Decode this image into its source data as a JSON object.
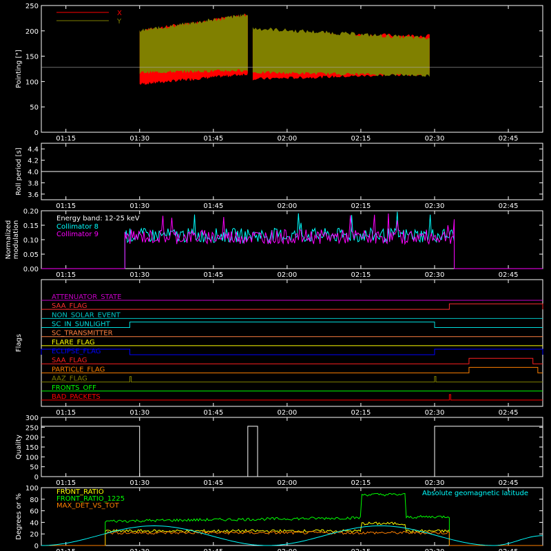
{
  "time_axis": {
    "start": "01:10",
    "end": "02:52",
    "tick_labels": [
      "01:15",
      "01:30",
      "01:45",
      "02:00",
      "02:15",
      "02:30",
      "02:45"
    ]
  },
  "chart_data": [
    {
      "id": "pointing",
      "type": "line",
      "ylabel": "Pointing [\"]",
      "ylim": [
        0,
        250
      ],
      "yticks": [
        0,
        50,
        100,
        150,
        200,
        250
      ],
      "reference_line": 128,
      "series": [
        {
          "name": "X",
          "color": "#ff0000",
          "bands": [
            {
              "t0": "01:30",
              "t1": "01:52",
              "low_start": 95,
              "low_end": 115,
              "high_start": 200,
              "high_end": 232
            },
            {
              "t0": "01:53",
              "t1": "02:29",
              "low_start": 105,
              "low_end": 115,
              "high_start": 195,
              "high_end": 190
            }
          ]
        },
        {
          "name": "Y",
          "color": "#808000",
          "bands": [
            {
              "t0": "01:30",
              "t1": "01:52",
              "low_start": 118,
              "low_end": 122,
              "high_start": 200,
              "high_end": 232
            },
            {
              "t0": "01:53",
              "t1": "02:29",
              "low_start": 118,
              "low_end": 112,
              "high_start": 205,
              "high_end": 185
            }
          ]
        }
      ]
    },
    {
      "id": "roll",
      "type": "line",
      "ylabel": "Roll period [s]",
      "ylim": [
        3.5,
        4.5
      ],
      "yticks": [
        3.6,
        3.8,
        4.0,
        4.2,
        4.4
      ],
      "series": [
        {
          "color": "#ffffff",
          "t": [
            "01:10",
            "02:52"
          ],
          "y": [
            4.0,
            4.0
          ]
        }
      ]
    },
    {
      "id": "modulation",
      "type": "line",
      "ylabel": "Normalized modulation",
      "ylim": [
        0,
        0.2
      ],
      "yticks": [
        0.0,
        0.05,
        0.1,
        0.15,
        0.2
      ],
      "annotation": "Energy band: 12-25 keV",
      "active_window": [
        "01:27",
        "02:34"
      ],
      "series": [
        {
          "name": "Collimator 8",
          "color": "#00ffff",
          "mean": 0.115
        },
        {
          "name": "Collimator 9",
          "color": "#ff00ff",
          "mean": 0.11
        }
      ]
    },
    {
      "id": "flags",
      "type": "line",
      "ylabel": "Flags",
      "flags": [
        {
          "name": "ATTENUATOR_STATE",
          "color": "#c800c8",
          "steps": []
        },
        {
          "name": "SAA_FLAG",
          "color": "#ff3030",
          "steps": [
            [
              "02:33",
              "02:52"
            ]
          ]
        },
        {
          "name": "NON_SOLAR_EVENT",
          "color": "#00c8c8",
          "steps": []
        },
        {
          "name": "SC_IN_SUNLIGHT",
          "color": "#00e0e0",
          "steps": [
            [
              "01:28",
              "02:30"
            ]
          ]
        },
        {
          "name": "SC_TRANSMITTER",
          "color": "#ff8040",
          "steps": []
        },
        {
          "name": "FLARE_FLAG",
          "color": "#ffff00",
          "steps": []
        },
        {
          "name": "ECLIPSE_FLAG",
          "color": "#0000ff",
          "steps": [
            [
              "01:10",
              "01:28"
            ],
            [
              "02:30",
              "02:52"
            ]
          ]
        },
        {
          "name": "SAA_FLAG",
          "color": "#ff2020",
          "steps": [
            [
              "02:37",
              "02:50"
            ]
          ]
        },
        {
          "name": "PARTICLE_FLAG",
          "color": "#ff8000",
          "steps": [
            [
              "02:37",
              "02:51"
            ]
          ]
        },
        {
          "name": "AAZ_FLAG",
          "color": "#808000",
          "steps": [
            [
              "01:28",
              "01:28"
            ],
            [
              "02:30",
              "02:30"
            ]
          ]
        },
        {
          "name": "FRONTS_OFF",
          "color": "#00ff00",
          "steps": []
        },
        {
          "name": "BAD_PACKETS",
          "color": "#ff0000",
          "steps": [
            [
              "02:33",
              "02:33"
            ]
          ]
        }
      ]
    },
    {
      "id": "quality",
      "type": "line",
      "ylabel": "Quality",
      "ylim": [
        0,
        300
      ],
      "yticks": [
        0,
        50,
        100,
        150,
        200,
        250,
        300
      ],
      "series": [
        {
          "color": "#ffffff",
          "t": [
            "01:10",
            "01:30",
            "01:30",
            "01:52",
            "01:52",
            "01:54",
            "01:54",
            "02:30",
            "02:30",
            "02:52"
          ],
          "y": [
            255,
            255,
            0,
            0,
            255,
            255,
            0,
            0,
            255,
            255
          ]
        }
      ]
    },
    {
      "id": "front_ratio",
      "type": "line",
      "ylabel": "Degrees or %",
      "ylim": [
        0,
        100
      ],
      "yticks": [
        0,
        20,
        40,
        60,
        80,
        100
      ],
      "active_window": [
        "01:23",
        "02:33"
      ],
      "series": [
        {
          "name": "FRONT_RATIO",
          "color": "#ffff00",
          "level": 25,
          "bump": [
            "02:15",
            "02:24",
            38
          ]
        },
        {
          "name": "FRONT_RATIO_1225",
          "color": "#00ff00",
          "level_start": 42,
          "level_end": 50,
          "bump": [
            "02:15",
            "02:24",
            88
          ]
        },
        {
          "name": "MAX_DET_VS_TOT",
          "color": "#ff8000",
          "level": 22
        },
        {
          "name": "Absolute geomagnetic latitude",
          "color": "#00ffff",
          "t": [
            "01:10",
            "01:33",
            "01:56",
            "02:19",
            "02:42",
            "02:52"
          ],
          "y": [
            0,
            34,
            0,
            34,
            0,
            17
          ]
        }
      ]
    }
  ]
}
